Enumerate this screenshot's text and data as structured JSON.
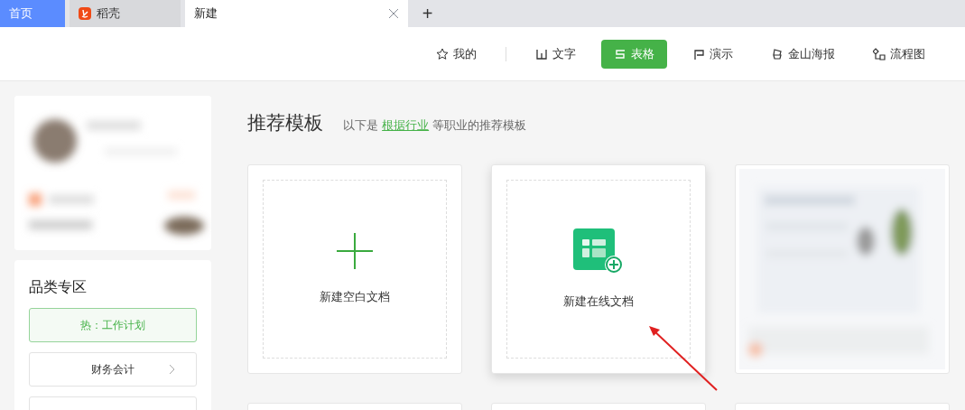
{
  "tabs": [
    {
      "label": "首页",
      "kind": "home",
      "selected": false
    },
    {
      "label": "稻壳",
      "kind": "app",
      "selected": false
    },
    {
      "label": "新建",
      "kind": "doc",
      "selected": true
    }
  ],
  "add_tab": "+",
  "toolbar": [
    {
      "label": "我的",
      "kind": "star",
      "selected": false
    },
    {
      "label": "文字",
      "kind": "w",
      "selected": false
    },
    {
      "label": "表格",
      "kind": "s",
      "selected": true
    },
    {
      "label": "演示",
      "kind": "p",
      "selected": false
    },
    {
      "label": "金山海报",
      "kind": "poster",
      "selected": false
    },
    {
      "label": "流程图",
      "kind": "flow",
      "selected": false
    }
  ],
  "sidebar": {
    "profile": {
      "kind": "picture"
    },
    "categories_title": "品类专区",
    "categories": [
      {
        "label": "热：工作计划",
        "selected": true,
        "chevron": false
      },
      {
        "label": "财务会计",
        "selected": false,
        "chevron": true
      }
    ]
  },
  "main": {
    "title": "推荐模板",
    "subtitle_before": "以下是",
    "subtitle_link": "根据行业",
    "subtitle_after": "等职业的推荐模板",
    "cards": [
      {
        "kind": "blank",
        "label": "新建空白文档",
        "highlighted": false
      },
      {
        "kind": "online",
        "label": "新建在线文档",
        "highlighted": true
      },
      {
        "kind": "picture"
      }
    ]
  },
  "annotation": {
    "kind": "arrow"
  }
}
